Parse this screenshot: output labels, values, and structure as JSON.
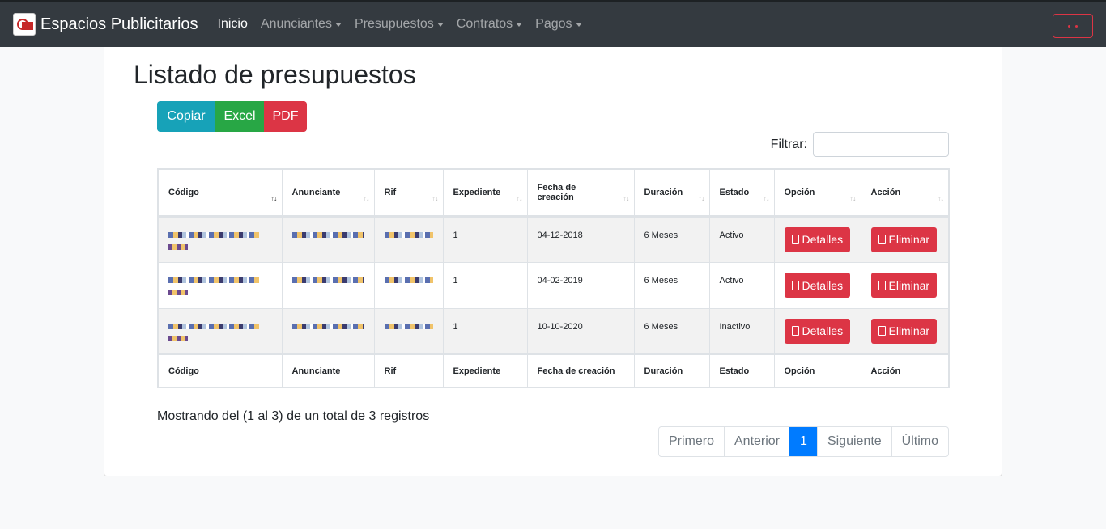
{
  "navbar": {
    "brand": "Espacios Publicitarios",
    "items": [
      {
        "label": "Inicio",
        "dropdown": false
      },
      {
        "label": "Anunciantes",
        "dropdown": true
      },
      {
        "label": "Presupuestos",
        "dropdown": true
      },
      {
        "label": "Contratos",
        "dropdown": true
      },
      {
        "label": "Pagos",
        "dropdown": true
      }
    ]
  },
  "page": {
    "title": "Listado de presupuestos",
    "export_buttons": {
      "copy": "Copiar",
      "excel": "Excel",
      "pdf": "PDF"
    },
    "filter_label": "Filtrar:",
    "filter_value": ""
  },
  "table": {
    "headers": [
      "Código",
      "Anunciante",
      "Rif",
      "Expediente",
      "Fecha de creación",
      "Duración",
      "Estado",
      "Opción",
      "Acción"
    ],
    "rows": [
      {
        "expediente": "1",
        "fecha": "04-12-2018",
        "duracion": "6 Meses",
        "estado": "Activo",
        "opcion": "Detalles",
        "accion": "Eliminar"
      },
      {
        "expediente": "1",
        "fecha": "04-02-2019",
        "duracion": "6 Meses",
        "estado": "Activo",
        "opcion": "Detalles",
        "accion": "Eliminar"
      },
      {
        "expediente": "1",
        "fecha": "10-10-2020",
        "duracion": "6 Meses",
        "estado": "Inactivo",
        "opcion": "Detalles",
        "accion": "Eliminar"
      }
    ]
  },
  "info": "Mostrando del (1 al 3) de un total de 3 registros",
  "pagination": {
    "first": "Primero",
    "prev": "Anterior",
    "current": "1",
    "next": "Siguiente",
    "last": "Último"
  },
  "colors": {
    "navbar": "#343a40",
    "danger": "#dc3545",
    "info": "#17a2b8",
    "success": "#28a745",
    "primary": "#007bff"
  }
}
